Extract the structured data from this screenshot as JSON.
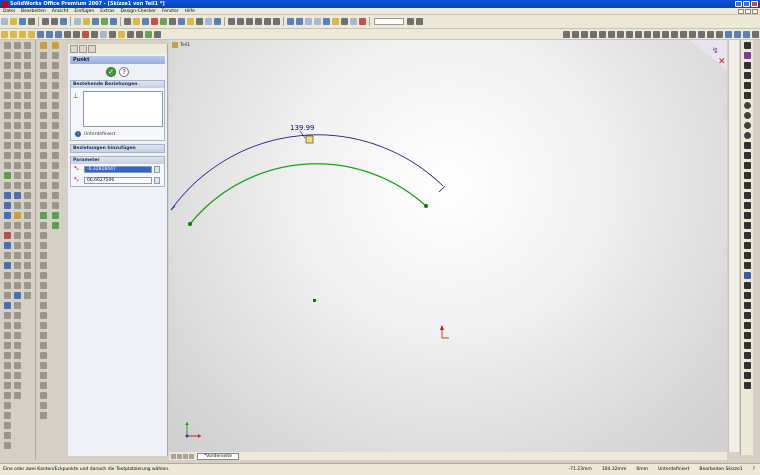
{
  "window": {
    "title": "SolidWorks Office Premium 2007 - [Skizze1 von Teil1 *]"
  },
  "menu": {
    "items": [
      "Datei",
      "Bearbeiten",
      "Ansicht",
      "Einfügen",
      "Extras",
      "Design-Checker",
      "Fenster",
      "Hilfe"
    ]
  },
  "tree": {
    "part_name": "Teil1"
  },
  "property_manager": {
    "title": "Punkt",
    "existing_relations": {
      "heading": "Bestehende Beziehungen",
      "status": "Unterdefiniert"
    },
    "add_relations": {
      "heading": "Beziehungen hinzufügen"
    },
    "parameters": {
      "heading": "Parameter",
      "x_value": "-6.32828447",
      "y_value": "66.6627506"
    }
  },
  "sketch": {
    "dimension_label": "139.99",
    "colors": {
      "construction_arc": "#1a1a80",
      "sketch_arc": "#18a018",
      "endpoint": "#0a7a0a",
      "origin": "#d01010"
    }
  },
  "bottom_tab": {
    "label": "*Vorderseite"
  },
  "status": {
    "message": "Eine oder zwei Kanten/Eckpunkte und danach die Textplatzierung wählen.",
    "x": "-71.23mm",
    "y": "104.32mm",
    "z": "0mm",
    "definition": "Unterdefiniert",
    "mode": "Bearbeiten Skizze1"
  },
  "icons": {
    "ok": "check-icon",
    "help": "help-icon",
    "info": "info-icon"
  }
}
